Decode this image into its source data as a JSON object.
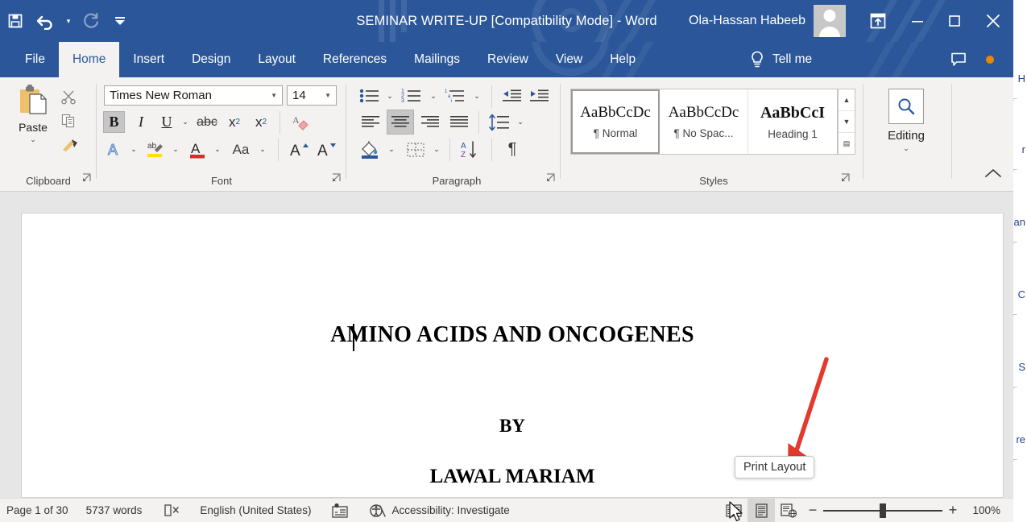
{
  "window": {
    "title": "SEMINAR WRITE-UP [Compatibility Mode]  -  Word",
    "account_name": "Ola-Hassan Habeeb",
    "accent_color": "#2b579a"
  },
  "quick_access": {
    "items": [
      {
        "name": "save-button",
        "icon": "save-icon",
        "label": "Save"
      },
      {
        "name": "undo-button",
        "icon": "undo-icon",
        "label": "Undo"
      },
      {
        "name": "redo-button",
        "icon": "redo-icon",
        "label": "Redo"
      },
      {
        "name": "customize-qat-button",
        "icon": "customize-toolbar-icon",
        "label": "Customize Quick Access Toolbar"
      }
    ]
  },
  "window_controls": {
    "ribbon_display_options": "Ribbon Display Options",
    "minimize": "Minimize",
    "maximize": "Maximize",
    "close": "Close"
  },
  "tabs": [
    {
      "label": "File",
      "active": false
    },
    {
      "label": "Home",
      "active": true
    },
    {
      "label": "Insert",
      "active": false
    },
    {
      "label": "Design",
      "active": false
    },
    {
      "label": "Layout",
      "active": false
    },
    {
      "label": "References",
      "active": false
    },
    {
      "label": "Mailings",
      "active": false
    },
    {
      "label": "Review",
      "active": false
    },
    {
      "label": "View",
      "active": false
    },
    {
      "label": "Help",
      "active": false
    }
  ],
  "tell_me": {
    "label": "Tell me",
    "icon": "lightbulb-icon"
  },
  "comments_button": {
    "label": "Comments",
    "icon": "comment-icon"
  },
  "ribbon": {
    "clipboard": {
      "label": "Clipboard",
      "paste_label": "Paste",
      "cut_label": "Cut",
      "copy_label": "Copy",
      "format_painter_label": "Format Painter",
      "launcher_label": "Clipboard dialog launcher"
    },
    "font": {
      "label": "Font",
      "font_family_value": "Times New Roman",
      "font_size_value": "14",
      "bold_label": "B",
      "italic_label": "I",
      "underline_label": "U",
      "strikethrough_label": "abc",
      "subscript_label": "x",
      "subscript_sub": "2",
      "superscript_label": "x",
      "superscript_sup": "2",
      "clear_formatting_label": "Clear All Formatting",
      "text_effects_label": "A",
      "highlight_label": "Text Highlight Color",
      "font_color_label": "A",
      "change_case_label": "Aa",
      "grow_font_label": "A",
      "shrink_font_label": "A",
      "launcher_label": "Font dialog launcher"
    },
    "paragraph": {
      "label": "Paragraph",
      "bullets_label": "Bullets",
      "numbering_label": "Numbering",
      "multilevel_label": "Multilevel List",
      "decrease_indent_label": "Decrease Indent",
      "increase_indent_label": "Increase Indent",
      "align_left_label": "Align Left",
      "align_center_label": "Center",
      "align_right_label": "Align Right",
      "justify_label": "Justify",
      "line_spacing_label": "Line and Paragraph Spacing",
      "shading_label": "Shading",
      "borders_label": "Borders",
      "sort_label": "Sort",
      "show_marks_label": "Show/Hide Formatting Marks",
      "launcher_label": "Paragraph dialog launcher"
    },
    "styles": {
      "label": "Styles",
      "items": [
        {
          "preview": "AaBbCcDc",
          "name": "¶ Normal",
          "selected": true
        },
        {
          "preview": "AaBbCcDc",
          "name": "¶ No Spac...",
          "selected": false
        },
        {
          "preview": "AaBbCcI",
          "name": "Heading 1",
          "selected": false
        }
      ],
      "scroll_up": "▲",
      "scroll_down": "▼",
      "more": "▤",
      "launcher_label": "Styles dialog launcher"
    },
    "editing": {
      "label": "Editing",
      "icon": "search-icon"
    },
    "collapse_label": "Collapse the Ribbon"
  },
  "document": {
    "lines": [
      {
        "text": "AMINO ACIDS AND ONCOGENES",
        "size": 28
      },
      {
        "text": "BY",
        "size": 23
      },
      {
        "text": "LAWAL MARIAM",
        "size": 25
      }
    ]
  },
  "tooltip": {
    "text": "Print Layout"
  },
  "annotation": {
    "arrow_color": "#e23b2e"
  },
  "status_bar": {
    "page_info": "Page 1 of 30",
    "word_count": "5737 words",
    "proofing_icon": "spelling-check-icon",
    "language": "English (United States)",
    "card_icon": "editor-card-icon",
    "accessibility_icon": "accessibility-icon",
    "accessibility_text": "Accessibility: Investigate",
    "views": [
      {
        "name": "read-mode-view-button",
        "label": "Read Mode",
        "active": false
      },
      {
        "name": "print-layout-view-button",
        "label": "Print Layout",
        "active": true
      },
      {
        "name": "web-layout-view-button",
        "label": "Web Layout",
        "active": false
      }
    ],
    "zoom_out_label": "−",
    "zoom_in_label": "+",
    "zoom_level": "100%"
  },
  "background_window": {
    "fragments": [
      "H",
      "r",
      "an",
      "C",
      "S",
      "re"
    ]
  }
}
